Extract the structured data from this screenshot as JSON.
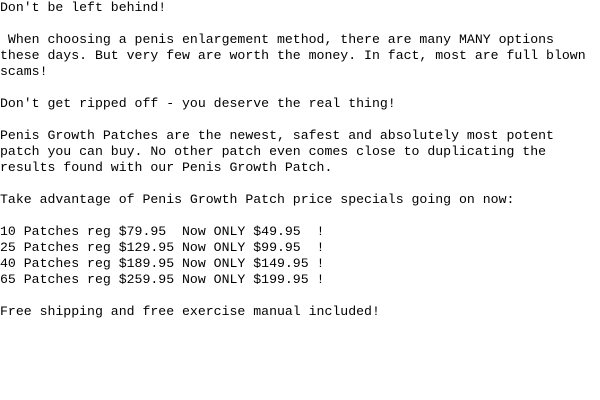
{
  "email_body": {
    "headline": "Don't be left behind!",
    "intro": [
      " When choosing a penis enlargement method, there are many MANY options",
      "these days. But very few are worth the money. In fact, most are full blown",
      "scams!"
    ],
    "warning": "Don't get ripped off - you deserve the real thing!",
    "pitch": [
      "Penis Growth Patches are the newest, safest and absolutely most potent",
      "patch you can buy. No other patch even comes close to duplicating the",
      "results found with our Penis Growth Patch."
    ],
    "specials_intro": "Take advantage of Penis Growth Patch price specials going on now:",
    "price_list": [
      "10 Patches reg $79.95  Now ONLY $49.95  !",
      "25 Patches reg $129.95 Now ONLY $99.95  !",
      "40 Patches reg $189.95 Now ONLY $149.95 !",
      "65 Patches reg $259.95 Now ONLY $199.95 !"
    ],
    "closing": "Free shipping and free exercise manual included!"
  }
}
